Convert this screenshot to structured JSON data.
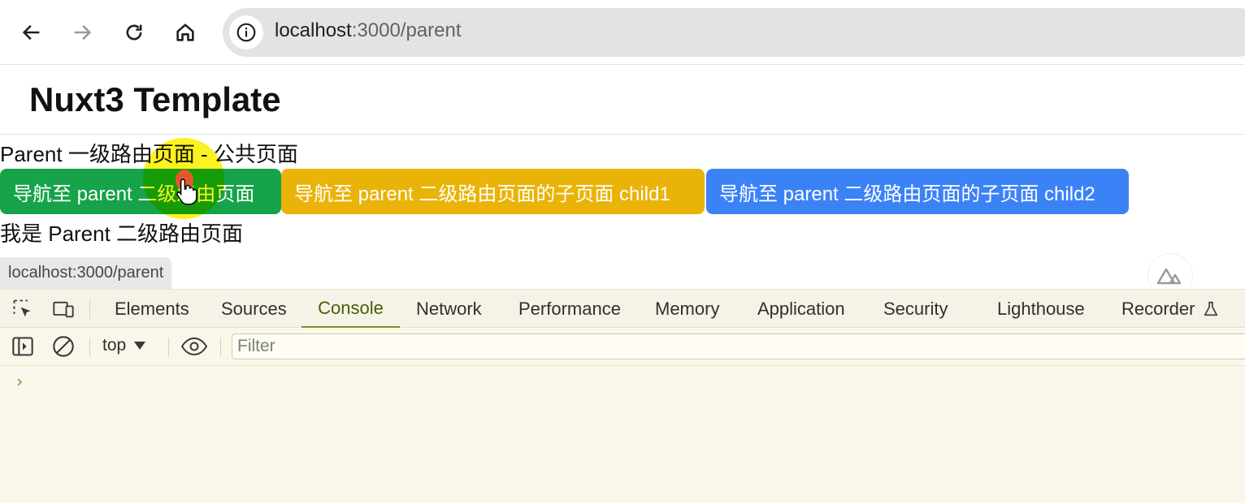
{
  "browser": {
    "url_host": "localhost",
    "url_path": ":3000/parent"
  },
  "page": {
    "title": "Nuxt3 Template",
    "line1": "Parent 一级路由页面 - 公共页面",
    "buttons": [
      {
        "label": "导航至 parent 二级路由页面",
        "color": "#16a34a"
      },
      {
        "label": "导航至 parent 二级路由页面的子页面 child1",
        "color": "#eab308"
      },
      {
        "label": "导航至 parent 二级路由页面的子页面 child2",
        "color": "#3b82f6"
      }
    ],
    "line2": "我是 Parent 二级路由页面"
  },
  "status_url": "localhost:3000/parent",
  "devtools": {
    "tabs": [
      "Elements",
      "Sources",
      "Console",
      "Network",
      "Performance",
      "Memory",
      "Application",
      "Security",
      "Lighthouse",
      "Recorder"
    ],
    "active_tab": "Console",
    "context": "top",
    "filter_placeholder": "Filter",
    "prompt": "›"
  },
  "colors": {
    "devtools_bg": "#faf7ea",
    "active_tab": "#4a5d00",
    "highlight": "#faf000"
  }
}
